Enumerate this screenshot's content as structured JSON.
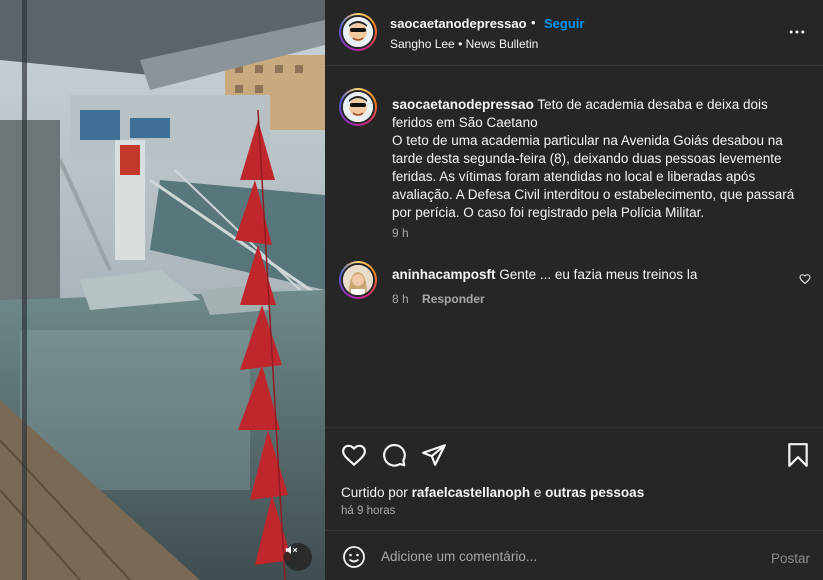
{
  "colors": {
    "background": "#262626",
    "text": "#f5f5f5",
    "secondary_text": "#a8a8a8",
    "link_blue": "#0095f6",
    "divider": "#363636"
  },
  "header": {
    "username": "saocaetanodepressao",
    "separator": "•",
    "follow_label": "Seguir",
    "subtitle": "Sangho Lee • News Bulletin",
    "more_icon": "more-horizontal-icon"
  },
  "caption": {
    "username": "saocaetanodepressao",
    "text": "Teto de academia desaba e deixa dois feridos em São Caetano",
    "body": "O teto de uma academia particular na Avenida Goiás desabou na tarde desta segunda-feira (8), deixando duas pessoas levemente feridas. As vítimas foram atendidas no local e liberadas após avaliação. A Defesa Civil interditou o estabelecimento, que passará por perícia. O caso foi registrado pela Polícia Militar.",
    "time": "9 h"
  },
  "comments": [
    {
      "username": "aninhacamposft",
      "text": "Gente ... eu fazia meus treinos la",
      "time": "8 h",
      "reply_label": "Responder"
    }
  ],
  "actions": {
    "like_icon": "heart-icon",
    "comment_icon": "comment-icon",
    "share_icon": "send-icon",
    "save_icon": "bookmark-icon"
  },
  "likes": {
    "prefix": "Curtido por",
    "user": "rafaelcastellanoph",
    "connector": "e",
    "others": "outras pessoas"
  },
  "post_time": "há 9 horas",
  "add_comment": {
    "placeholder": "Adicione um comentário...",
    "post_label": "Postar"
  },
  "media": {
    "mute_icon": "muted-speaker-icon"
  }
}
